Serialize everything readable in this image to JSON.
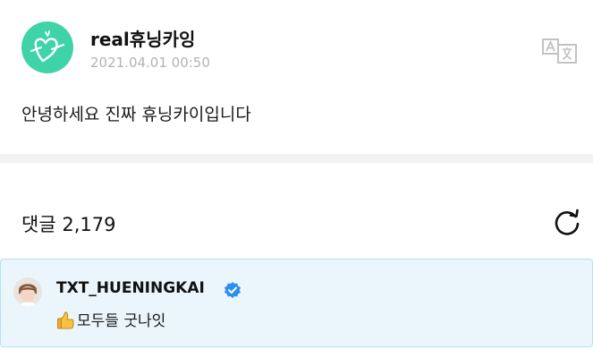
{
  "post": {
    "author": "real휴닝카잉",
    "timestamp": "2021.04.01 00:50",
    "text": "안녕하세요 진짜 휴닝카이입니다",
    "translate_icon": "translate-icon"
  },
  "comments": {
    "label": "댓글",
    "count": "2,179",
    "refresh_icon": "refresh-icon"
  },
  "comment_list": [
    {
      "author": "TXT_HUENINGKAI",
      "verified": true,
      "emoji": "thumbs-up",
      "text": "모두들 굿나잇"
    }
  ],
  "colors": {
    "avatar_bg": "#3fd3a8",
    "timestamp": "#b3b3b3",
    "comment_bg": "#eaf6fb",
    "comment_border": "#b9e0ef",
    "verified": "#2e8ef0"
  }
}
